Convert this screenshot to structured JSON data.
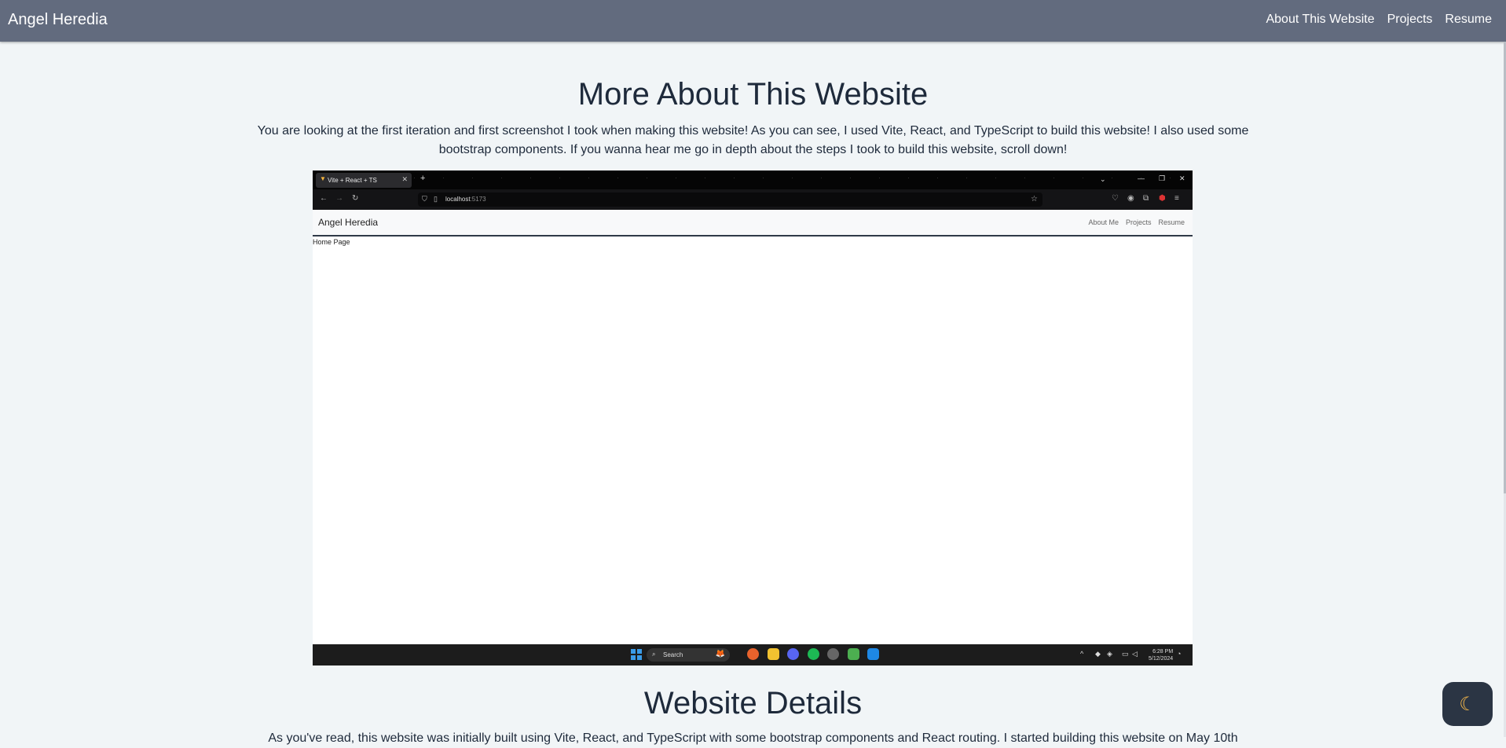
{
  "navbar": {
    "brand": "Angel Heredia",
    "links": [
      "About This Website",
      "Projects",
      "Resume"
    ]
  },
  "page": {
    "title": "More About This Website",
    "intro": "You are looking at the first iteration and first screenshot I took when making this website! As you can see, I used Vite, React, and TypeScript to build this website! I also used some bootstrap components. If you wanna hear me go in depth about the steps I took to build this website, scroll down!",
    "section_title": "Website Details",
    "section_text_partial": "As you've read, this website was initially built using Vite, React, and TypeScript with some bootstrap components and React routing. I started building this website on May 10th"
  },
  "screenshot": {
    "tab_title": "Vite + React + TS",
    "url_host": "localhost",
    "url_port": ":5173",
    "inner_brand": "Angel Heredia",
    "inner_links": [
      "About Me",
      "Projects",
      "Resume"
    ],
    "home_text": "Home Page",
    "taskbar_search": "Search",
    "time": "6:28 PM",
    "date": "5/12/2024"
  },
  "colors": {
    "navbar_bg": "#626b7e",
    "page_bg": "#f1f5f7",
    "text": "#1e2a3b",
    "theme_button_bg": "#2b3544"
  },
  "icons": {
    "theme_toggle": "moon-icon"
  }
}
